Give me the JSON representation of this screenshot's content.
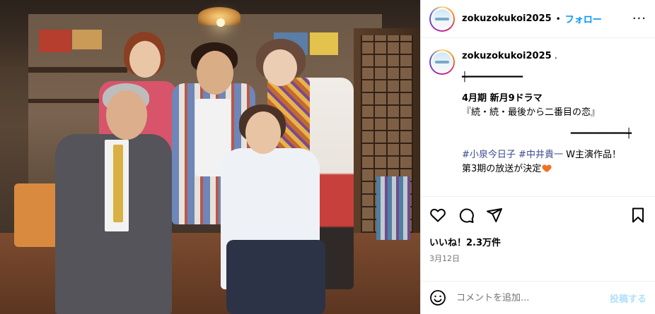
{
  "post": {
    "username": "zokuzokukoi2025",
    "dot": "•",
    "follow_label": "フォロー",
    "more_label": "···"
  },
  "caption": {
    "username": "zokuzokukoi2025",
    "suffix": " .",
    "line1": "┿━━━━━━━━━━",
    "line2": "4月期 新月9ドラマ",
    "line3": "『続・続・最後から二番目の恋』",
    "line4": "━━━━━━━━━━┿",
    "hashtag1": "#小泉今日子",
    "hashtag2": "#中井貴一",
    "line5_tail": " W主演作品！",
    "line6": "第3期の放送が決定"
  },
  "engagement": {
    "likes": "いいね！2.3万件",
    "date": "3月12日"
  },
  "comment": {
    "placeholder": "コメントを追加...",
    "post_label": "投稿する"
  },
  "colors": {
    "link": "#0095f6",
    "hashtag": "#3c4b8f",
    "heart": "#f0712a"
  }
}
